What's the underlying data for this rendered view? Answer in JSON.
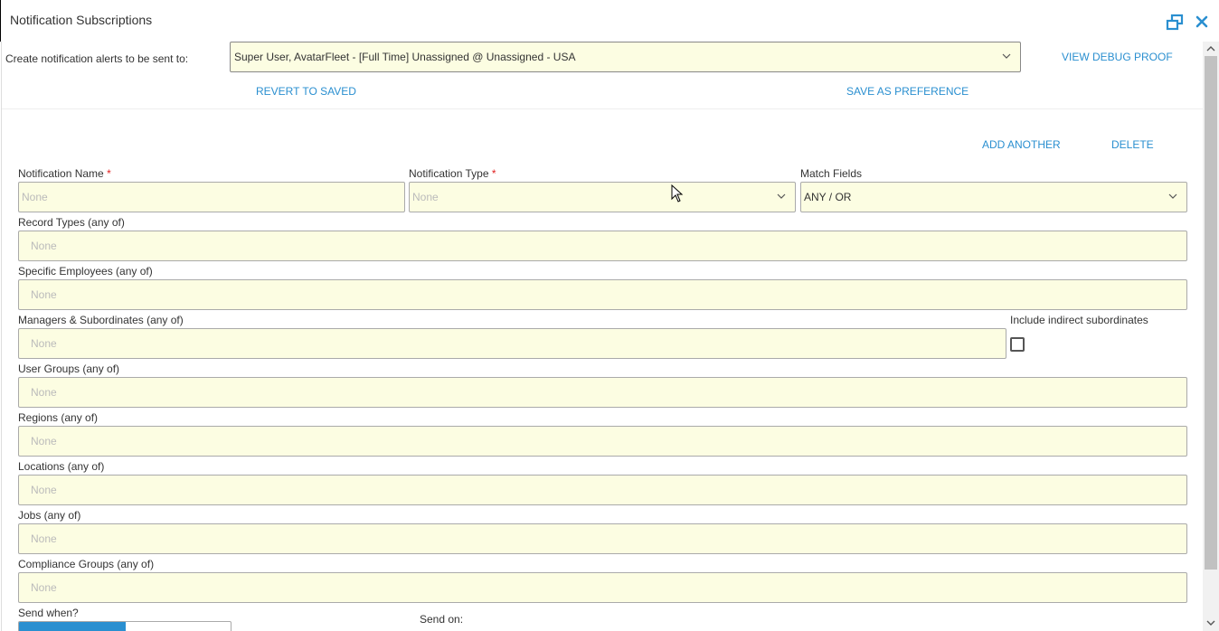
{
  "window": {
    "title": "Notification Subscriptions",
    "restore_icon": "restore-window-icon",
    "close_icon": "close-icon",
    "accent_color": "#2a8fd0"
  },
  "recipient": {
    "label": "Create notification alerts to be sent to:",
    "value": "Super User, AvatarFleet - [Full Time] Unassigned @ Unassigned - USA"
  },
  "actions": {
    "view_debug_proof": "VIEW DEBUG PROOF",
    "revert_to_saved": "REVERT TO SAVED",
    "save_as_preference": "SAVE AS PREFERENCE",
    "add_another": "ADD ANOTHER",
    "delete": "DELETE"
  },
  "form": {
    "notification_name": {
      "label": "Notification Name",
      "required_mark": "*",
      "placeholder": "None"
    },
    "notification_type": {
      "label": "Notification Type",
      "required_mark": "*",
      "placeholder": "None"
    },
    "match_fields": {
      "label": "Match Fields",
      "value": "ANY / OR"
    },
    "record_types": {
      "label": "Record Types (any of)",
      "placeholder": "None"
    },
    "specific_employees": {
      "label": "Specific Employees (any of)",
      "placeholder": "None"
    },
    "managers_subordinates": {
      "label": "Managers & Subordinates (any of)",
      "placeholder": "None"
    },
    "include_indirect": {
      "label": "Include indirect subordinates",
      "checked": false
    },
    "user_groups": {
      "label": "User Groups (any of)",
      "placeholder": "None"
    },
    "regions": {
      "label": "Regions (any of)",
      "placeholder": "None"
    },
    "locations": {
      "label": "Locations (any of)",
      "placeholder": "None"
    },
    "jobs": {
      "label": "Jobs (any of)",
      "placeholder": "None"
    },
    "compliance_groups": {
      "label": "Compliance Groups (any of)",
      "placeholder": "None"
    },
    "send_when": {
      "label": "Send when?"
    },
    "send_on": {
      "label": "Send on:"
    }
  }
}
